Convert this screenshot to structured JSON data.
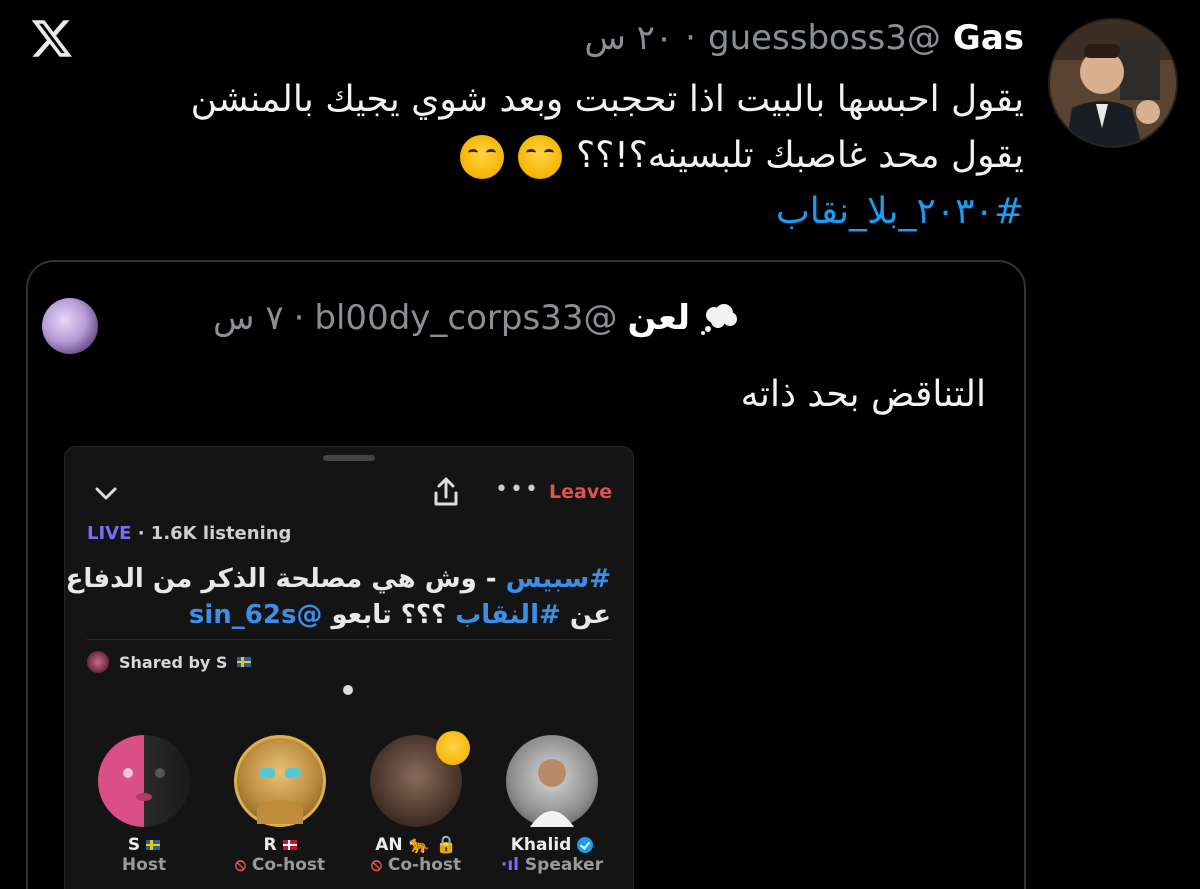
{
  "app": {
    "logo": "x-logo-icon"
  },
  "tweet": {
    "author_name": "Gas",
    "handle": "@guessboss3",
    "separator": "·",
    "time": "٢٠ س",
    "text_line1": "يقول احبسها بالبيت اذا تحجبت وبعد شوي يجيك بالمنشن",
    "text_line2": "يقول محد غاصبك تلبسينه؟!؟؟",
    "hashtag": "#٢٠٣٠_بلا_نقاب",
    "emojis": [
      "crying-face-icon",
      "crying-face-icon"
    ]
  },
  "quote": {
    "author_name": "لعن",
    "handle": "@bl00dy_corps33",
    "separator": "·",
    "time": "٧ س",
    "text": "التناقض بحد ذاته",
    "badge_icon": "thought-bubble-icon"
  },
  "space": {
    "leave_label": "Leave",
    "live_label": "LIVE",
    "listening": "· 1.6K listening",
    "title_hashtag1": "#سبيس",
    "title_rest1": " - وش هي مصلحة الذكر من الدفاع",
    "title_prefix2": "عن ",
    "title_hashtag2": "#النقاب",
    "title_mid2": " ؟؟؟ تابعو ",
    "title_mention2": "@sin_62s",
    "shared_by": "Shared by S",
    "participants": [
      {
        "name": "S",
        "role": "Host",
        "flag": "sweden"
      },
      {
        "name": "R",
        "role": "Co-host",
        "flag": "denmark"
      },
      {
        "name": "AN",
        "role": "Co-host",
        "badge": "leopard-lock"
      },
      {
        "name": "Khalid",
        "role": "Speaker",
        "verified": true
      }
    ]
  },
  "colors": {
    "background": "#000000",
    "link": "#1d9bf0",
    "muted": "#8b8f94",
    "leave": "#e0534a",
    "live": "#7b6ef6"
  }
}
